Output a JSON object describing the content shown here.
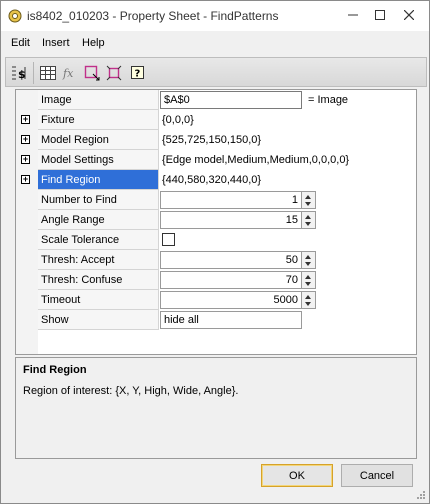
{
  "window": {
    "title": "is8402_010203 - Property Sheet - FindPatterns"
  },
  "menu": {
    "items": [
      "Edit",
      "Insert",
      "Help"
    ]
  },
  "toolbar": {
    "buttons": [
      "sort-properties-icon",
      "table-grid-icon",
      "function-fx-icon",
      "select-region-icon",
      "fit-region-icon",
      "help-icon"
    ]
  },
  "properties": {
    "image": {
      "label": "Image",
      "value": "$A$0",
      "suffix": "= Image"
    },
    "fixture": {
      "label": "Fixture",
      "value": "{0,0,0}"
    },
    "model_region": {
      "label": "Model Region",
      "value": "{525,725,150,150,0}"
    },
    "model_settings": {
      "label": "Model Settings",
      "value": "{Edge model,Medium,Medium,0,0,0,0}"
    },
    "find_region": {
      "label": "Find Region",
      "value": "{440,580,320,440,0}"
    },
    "number_to_find": {
      "label": "Number to Find",
      "value": "1"
    },
    "angle_range": {
      "label": "Angle Range",
      "value": "15"
    },
    "scale_tolerance": {
      "label": "Scale Tolerance",
      "checked": false
    },
    "thresh_accept": {
      "label": "Thresh: Accept",
      "value": "50"
    },
    "thresh_confuse": {
      "label": "Thresh: Confuse",
      "value": "70"
    },
    "timeout": {
      "label": "Timeout",
      "value": "5000"
    },
    "show": {
      "label": "Show",
      "value": "hide all"
    }
  },
  "description": {
    "title": "Find Region",
    "text": "Region of interest: {X, Y, High, Wide, Angle}."
  },
  "buttons": {
    "ok": "OK",
    "cancel": "Cancel"
  },
  "colors": {
    "selection": "#2f6fd8",
    "ok_border": "#d6a22a"
  }
}
